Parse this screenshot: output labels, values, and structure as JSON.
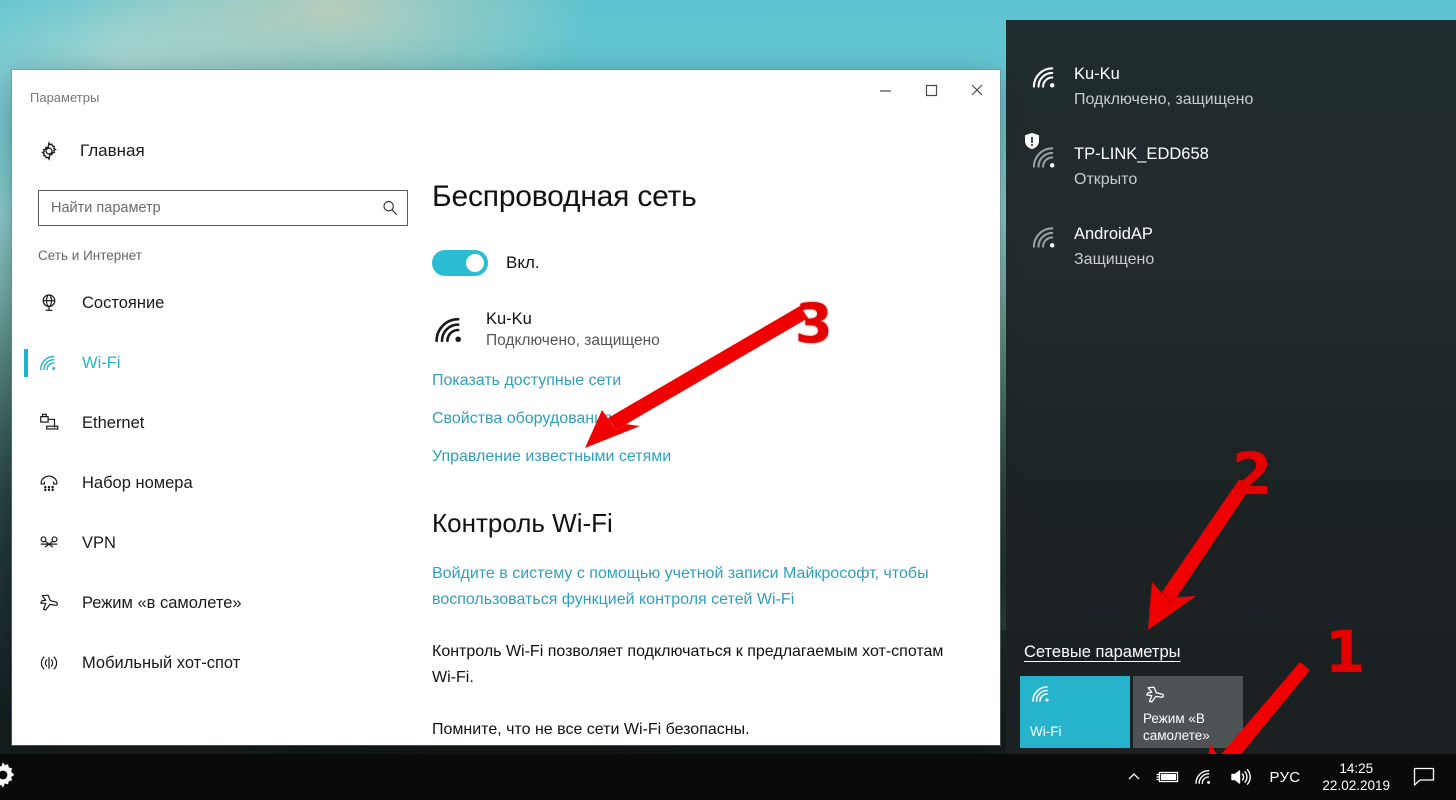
{
  "window": {
    "title": "Параметры",
    "controls": {
      "minimize": "minimize-icon",
      "maximize": "maximize-icon",
      "close": "close-icon"
    }
  },
  "sidebar": {
    "home_label": "Главная",
    "search": {
      "placeholder": "Найти параметр",
      "value": ""
    },
    "group_title": "Сеть и Интернет",
    "items": [
      {
        "label": "Состояние",
        "icon": "globe-icon",
        "active": false
      },
      {
        "label": "Wi-Fi",
        "icon": "wifi-icon",
        "active": true
      },
      {
        "label": "Ethernet",
        "icon": "ethernet-icon",
        "active": false
      },
      {
        "label": "Набор номера",
        "icon": "dialup-icon",
        "active": false
      },
      {
        "label": "VPN",
        "icon": "vpn-icon",
        "active": false
      },
      {
        "label": "Режим «в самолете»",
        "icon": "airplane-icon",
        "active": false
      },
      {
        "label": "Мобильный хот-спот",
        "icon": "hotspot-icon",
        "active": false
      }
    ]
  },
  "content": {
    "heading": "Беспроводная сеть",
    "toggle_label": "Вкл.",
    "toggle_state": "on",
    "current_network": {
      "ssid": "Ku-Ku",
      "status": "Подключено, защищено",
      "icon": "wifi-icon"
    },
    "links": [
      "Показать доступные сети",
      "Свойства оборудования",
      "Управление известными сетями"
    ],
    "section2_heading": "Контроль Wi-Fi",
    "ms_account_link": "Войдите в систему с помощью учетной записи Майкрософт, чтобы воспользоваться функцией контроля сетей Wi-Fi",
    "paragraph1": "Контроль Wi-Fi позволяет подключаться к предлагаемым хот-спотам Wi-Fi.",
    "paragraph2": "Помните, что не все сети Wi-Fi безопасны."
  },
  "flyout": {
    "networks": [
      {
        "ssid": "Ku-Ku",
        "status": "Подключено, защищено",
        "icon": "wifi-icon",
        "warning": false
      },
      {
        "ssid": "TP-LINK_EDD658",
        "status": "Открыто",
        "icon": "wifi-icon",
        "warning": true
      },
      {
        "ssid": "AndroidAP",
        "status": "Защищено",
        "icon": "wifi-icon",
        "warning": false
      }
    ],
    "settings_link": "Сетевые параметры",
    "quick_actions": [
      {
        "label": "Wi-Fi",
        "icon": "wifi-icon",
        "state": "on"
      },
      {
        "label": "Режим «В самолете»",
        "icon": "airplane-icon",
        "state": "off"
      }
    ]
  },
  "taskbar": {
    "start_icon": "gear-icon",
    "tray": [
      "chevron-up-icon",
      "battery-icon",
      "wifi-icon",
      "volume-icon"
    ],
    "language": "РУС",
    "time": "14:25",
    "date": "22.02.2019",
    "action_center_icon": "action-center-icon"
  },
  "annotations": {
    "colors": {
      "marker": "#e50000",
      "accent": "#26b3cc"
    },
    "markers": [
      {
        "number": "1",
        "target": "taskbar-wifi-icon"
      },
      {
        "number": "2",
        "target": "net-settings-link"
      },
      {
        "number": "3",
        "target": "manage-known-networks-link"
      }
    ]
  }
}
